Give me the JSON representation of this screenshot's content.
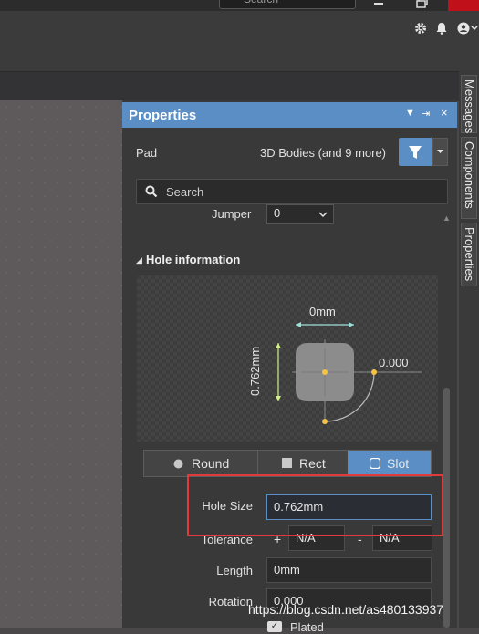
{
  "top": {
    "search_placeholder": "Search"
  },
  "side_tabs": [
    "Messages",
    "Components",
    "Properties"
  ],
  "panel": {
    "title": "Properties",
    "object_type": "Pad",
    "filter_text": "3D Bodies (and 9 more)",
    "search_placeholder": "Search",
    "jumper_label": "Jumper",
    "jumper_value": "0"
  },
  "hole": {
    "section_title": "Hole information",
    "width_label": "0mm",
    "height_label": "0.762mm",
    "rotation_label": "0.000",
    "shapes": [
      "Round",
      "Rect",
      "Slot"
    ],
    "selected_shape": "Slot",
    "hole_size_label": "Hole Size",
    "hole_size_value": "0.762mm",
    "tolerance_label": "Tolerance",
    "tolerance_plus_sign": "+",
    "tolerance_plus_value": "N/A",
    "tolerance_minus_sign": "-",
    "tolerance_minus_value": "N/A",
    "length_label": "Length",
    "length_value": "0mm",
    "rotation_field_label": "Rotation",
    "rotation_value": "0.000",
    "plated_label": "Plated",
    "plated_checked": true
  },
  "watermark": "https://blog.csdn.net/as480133937",
  "colors": {
    "accent": "#5a8ec4",
    "highlight": "#e03a3a",
    "close": "#c0101a"
  }
}
